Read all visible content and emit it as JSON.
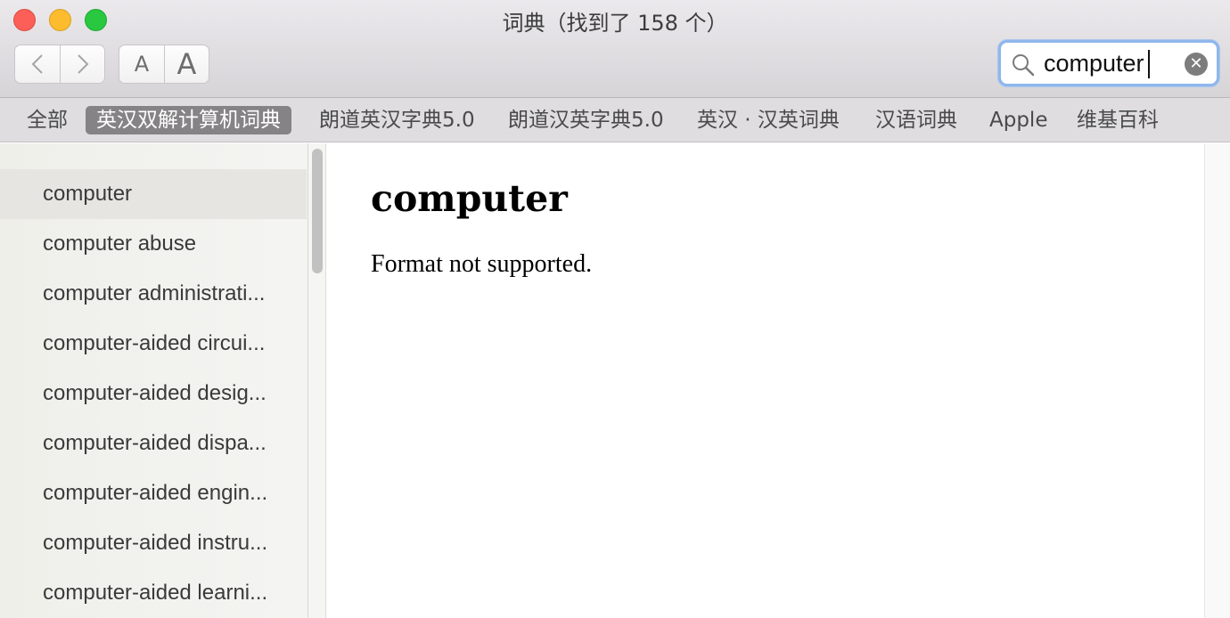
{
  "window": {
    "title": "词典（找到了 158 个）"
  },
  "toolbar": {
    "back_label": "‹",
    "forward_label": "›",
    "font_smaller_label": "A",
    "font_larger_label": "A"
  },
  "search": {
    "value": "computer",
    "clear_label": "✕"
  },
  "scopes": [
    {
      "label": "全部"
    },
    {
      "label": "英汉双解计算机词典"
    },
    {
      "label": "朗道英汉字典5.0"
    },
    {
      "label": "朗道汉英字典5.0"
    },
    {
      "label": "英汉 · 汉英词典"
    },
    {
      "label": "汉语词典"
    },
    {
      "label": "Apple"
    },
    {
      "label": "维基百科"
    }
  ],
  "active_scope": "英汉双解计算机词典",
  "results": [
    {
      "label": "computer"
    },
    {
      "label": "computer abuse"
    },
    {
      "label": "computer administrati..."
    },
    {
      "label": "computer-aided circui..."
    },
    {
      "label": "computer-aided desig..."
    },
    {
      "label": "computer-aided dispa..."
    },
    {
      "label": "computer-aided engin..."
    },
    {
      "label": "computer-aided instru..."
    },
    {
      "label": "computer-aided learni..."
    }
  ],
  "entry": {
    "headword": "computer",
    "body": "Format not supported."
  },
  "colors": {
    "accent_focus": "#8fb7ec",
    "scope_active_bg": "#858385"
  }
}
